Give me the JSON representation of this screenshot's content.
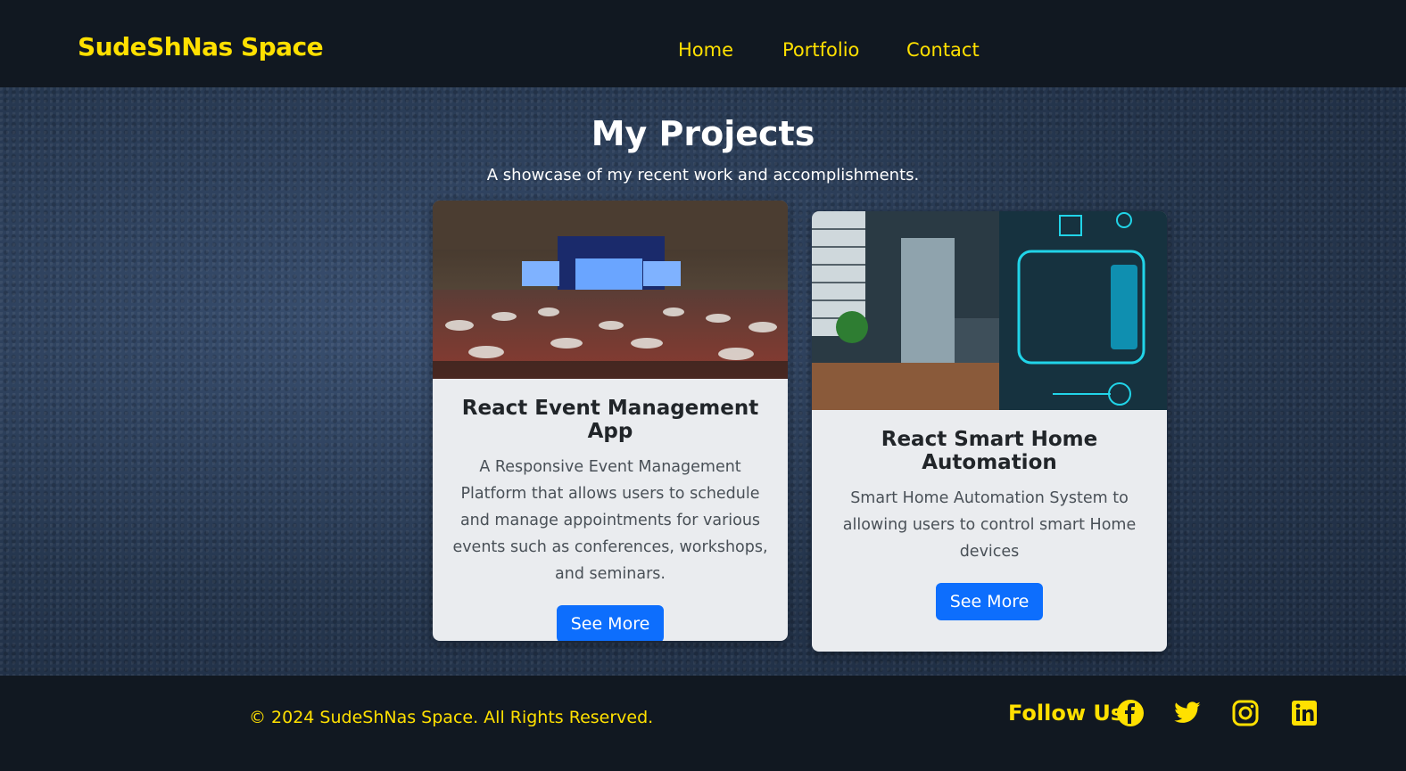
{
  "navbar": {
    "brand": "SudeShNas Space",
    "links": [
      "Home",
      "Portfolio",
      "Contact"
    ]
  },
  "main": {
    "title": "My Projects",
    "subtitle": "A showcase of my recent work and accomplishments.",
    "projects": [
      {
        "title": "React Event Management App",
        "description": "A Responsive Event Management Platform that allows users to schedule and manage appointments for various events such as conferences, workshops, and seminars.",
        "button": "See More",
        "image": "conference-hall-photo"
      },
      {
        "title": "React Smart Home Automation",
        "description": "Smart Home Automation System to allowing users to control smart Home devices",
        "button": "See More",
        "image": "smart-home-kitchen-photo"
      }
    ]
  },
  "footer": {
    "copyright": "© 2024 SudeShNas Space. All Rights Reserved.",
    "follow_label": "Follow Us",
    "social": [
      "facebook-icon",
      "twitter-icon",
      "instagram-icon",
      "linkedin-icon"
    ]
  },
  "colors": {
    "accent": "#ffe000",
    "primary_button": "#0d6efd",
    "dark_bg": "#111821"
  }
}
